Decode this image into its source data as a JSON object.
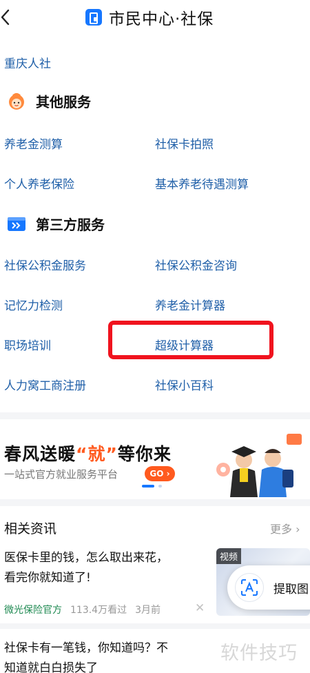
{
  "header": {
    "title": "市民中心·社保"
  },
  "top_link": "重庆人社",
  "sections": [
    {
      "title": "其他服务",
      "icon": "mascot-icon",
      "items": [
        "养老金测算",
        "社保卡拍照",
        "个人养老保险",
        "基本养老待遇测算"
      ]
    },
    {
      "title": "第三方服务",
      "icon": "forward-icon",
      "items": [
        "社保公积金服务",
        "社保公积金咨询",
        "记忆力检测",
        "养老金计算器",
        "职场培训",
        "超级计算器",
        "人力窝工商注册",
        "社保小百科"
      ]
    }
  ],
  "highlighted_item": "超级计算器",
  "banner": {
    "headline_part1": "春风送暖",
    "headline_highlight": "“就”",
    "headline_part2": "等你来",
    "subtitle": "一站式官方就业服务平台",
    "go_label": "GO",
    "accent": "#ff5a1f"
  },
  "news": {
    "title": "相关资讯",
    "more_label": "更多",
    "items": [
      {
        "title_line1": "医保卡里的钱，怎么取出来花，",
        "title_line2": "看完你就知道了!",
        "source": "微光保险官方",
        "views": "113.4万看过",
        "time": "3月前",
        "thumb_tag": "视频"
      },
      {
        "title_line1": "社保卡有一笔钱，你知道吗？不",
        "title_line2": "知道就白白损失了"
      }
    ]
  },
  "ocr_button": {
    "label": "提取图"
  },
  "watermark": "软件技巧",
  "colors": {
    "link": "#1f5fa8",
    "brand": "#1677ff",
    "highlight_box": "#f0131e",
    "source": "#1f8a52"
  }
}
